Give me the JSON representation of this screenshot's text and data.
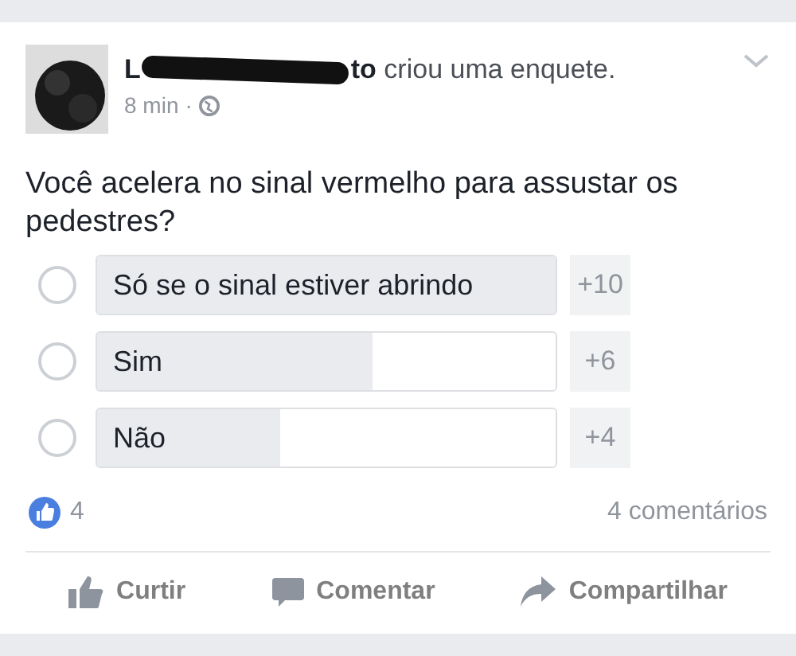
{
  "post": {
    "author_start": "L",
    "author_end": "to",
    "action": "criou uma enquete.",
    "time": "8 min",
    "separator": "·"
  },
  "question": "Você acelera no sinal vermelho para assustar os pedestres?",
  "poll_options": [
    {
      "label": "Só se o sinal estiver abrindo",
      "count": "+10",
      "level": 1.0,
      "selected": false
    },
    {
      "label": "Sim",
      "count": "+6",
      "level": 0.6,
      "selected": false
    },
    {
      "label": "Não",
      "count": "+4",
      "level": 0.4,
      "selected": false
    }
  ],
  "reactions": {
    "likes": "4",
    "comments": "4 comentários"
  },
  "actions": [
    {
      "kind": "like",
      "label": "Curtir"
    },
    {
      "kind": "comment",
      "label": "Comentar"
    },
    {
      "kind": "share",
      "label": "Compartilhar"
    }
  ]
}
